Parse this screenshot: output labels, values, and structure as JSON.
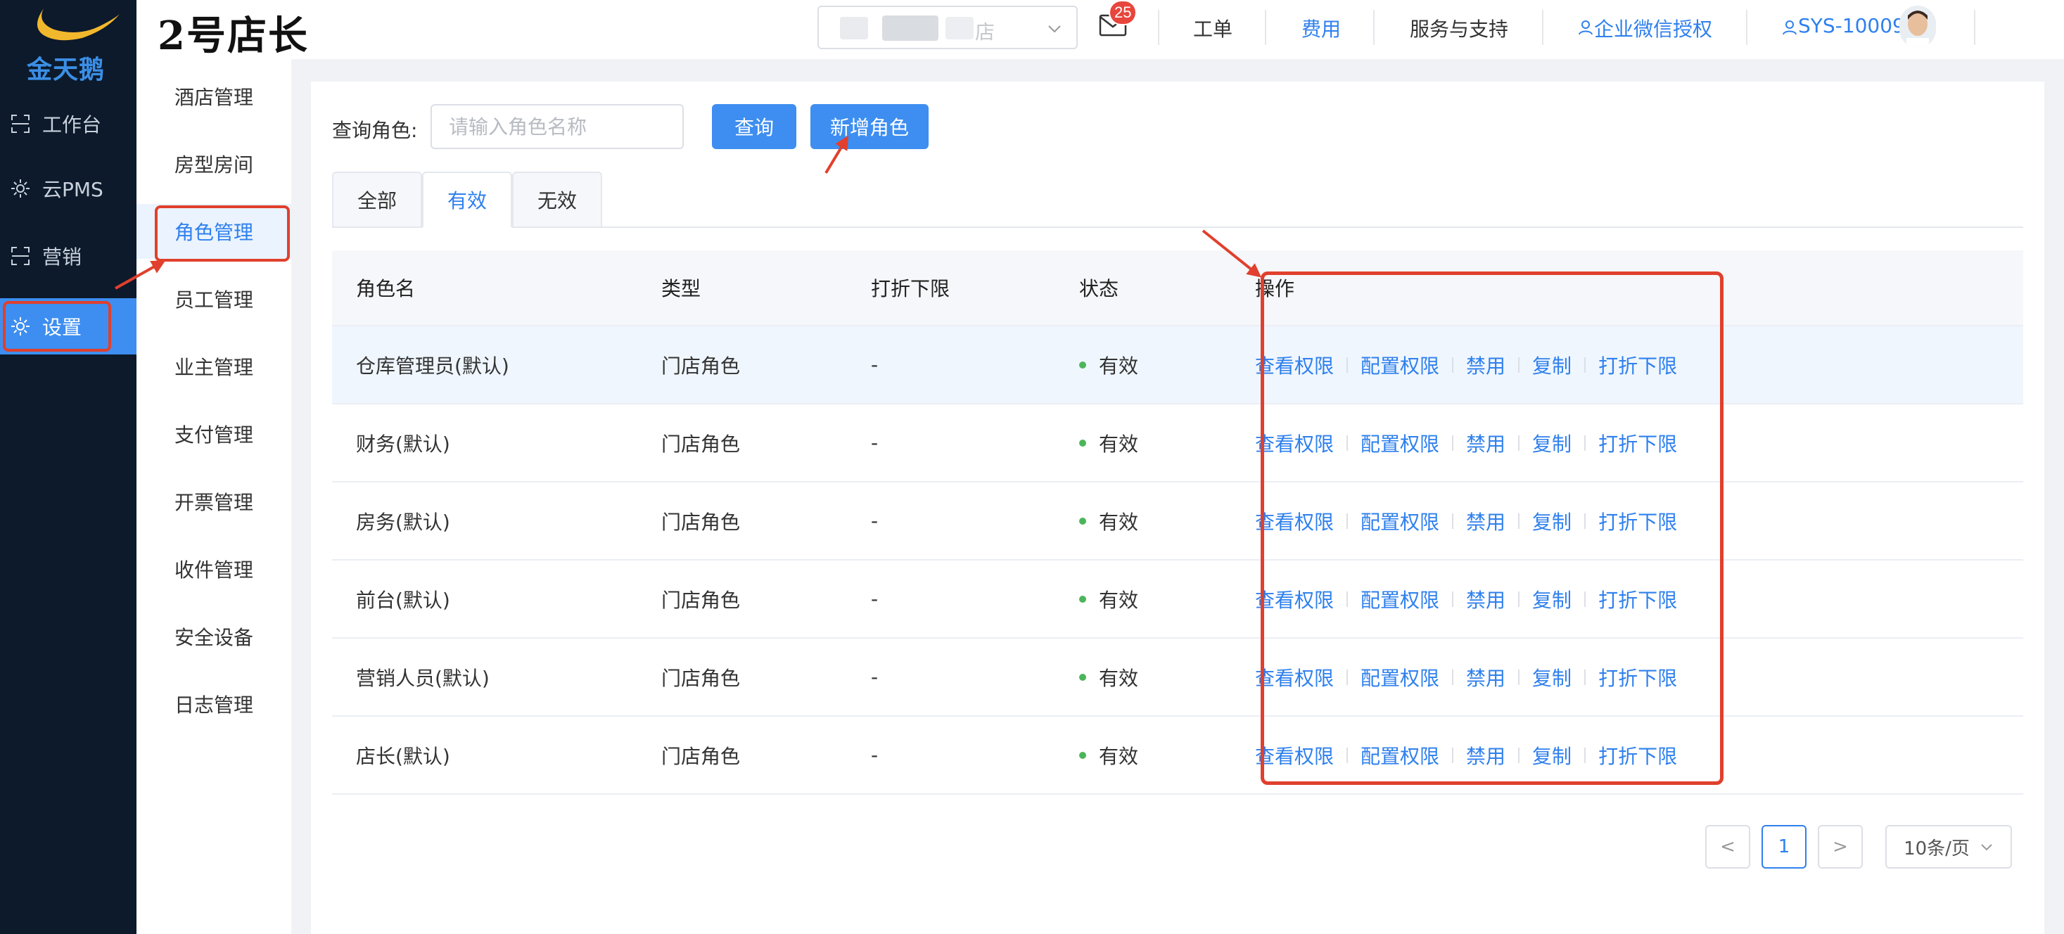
{
  "brand": {
    "logo_text": "金天鹅",
    "title": "2号店长"
  },
  "sidebar": {
    "items": [
      {
        "label": "工作台",
        "icon": "workbench-icon"
      },
      {
        "label": "云PMS",
        "icon": "gear-icon"
      },
      {
        "label": "营销",
        "icon": "marketing-icon"
      },
      {
        "label": "设置",
        "icon": "settings-icon"
      }
    ]
  },
  "submenu": {
    "items": [
      {
        "label": "酒店管理"
      },
      {
        "label": "房型房间"
      },
      {
        "label": "角色管理"
      },
      {
        "label": "员工管理"
      },
      {
        "label": "业主管理"
      },
      {
        "label": "支付管理"
      },
      {
        "label": "开票管理"
      },
      {
        "label": "收件管理"
      },
      {
        "label": "安全设备"
      },
      {
        "label": "日志管理"
      }
    ]
  },
  "header": {
    "store_suffix": "店",
    "mail_count": "25",
    "links": {
      "ticket": "工单",
      "fees": "费用",
      "service": "服务与支持",
      "wechat": "企业微信授权",
      "user": "SYS-10009"
    }
  },
  "query": {
    "label": "查询角色:",
    "placeholder": "请输入角色名称",
    "search_btn": "查询",
    "add_btn": "新增角色"
  },
  "tabs": {
    "all": "全部",
    "valid": "有效",
    "invalid": "无效"
  },
  "table": {
    "headers": {
      "name": "角色名",
      "type": "类型",
      "discount": "打折下限",
      "status": "状态",
      "actions": "操作"
    },
    "rows": [
      {
        "name": "仓库管理员(默认)",
        "type": "门店角色",
        "discount": "-",
        "status": "有效"
      },
      {
        "name": "财务(默认)",
        "type": "门店角色",
        "discount": "-",
        "status": "有效"
      },
      {
        "name": "房务(默认)",
        "type": "门店角色",
        "discount": "-",
        "status": "有效"
      },
      {
        "name": "前台(默认)",
        "type": "门店角色",
        "discount": "-",
        "status": "有效"
      },
      {
        "name": "营销人员(默认)",
        "type": "门店角色",
        "discount": "-",
        "status": "有效"
      },
      {
        "name": "店长(默认)",
        "type": "门店角色",
        "discount": "-",
        "status": "有效"
      }
    ],
    "actions": {
      "view": "查看权限",
      "config": "配置权限",
      "disable": "禁用",
      "copy": "复制",
      "discount": "打折下限"
    }
  },
  "pagination": {
    "prev": "<",
    "page": "1",
    "next": ">",
    "size": "10条/页"
  },
  "colors": {
    "primary": "#3d8ef0",
    "link": "#2f80ed",
    "sidebar_bg": "#0c1a2b",
    "annotation": "#e0402d",
    "status_dot": "#4cb55a"
  }
}
